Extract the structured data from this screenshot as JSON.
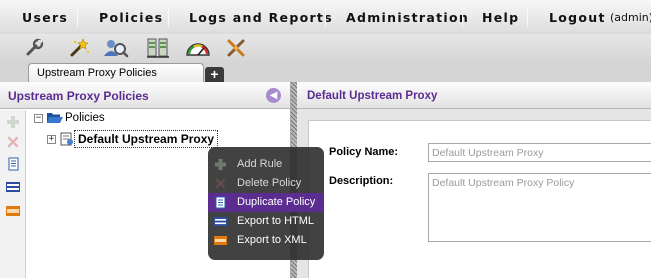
{
  "menu": {
    "items": [
      "Users",
      "Policies",
      "Logs and Reports",
      "Administration",
      "Help",
      "Logout"
    ],
    "user_badge": "(admin)"
  },
  "toolbar": {
    "icons": [
      "wrench-icon",
      "wand-icon",
      "user-search-icon",
      "server-icon",
      "gauge-icon",
      "crossed-tools-icon"
    ]
  },
  "tabs": {
    "active_tab_label": "Upstream Proxy Policies",
    "new_tab_label": "+"
  },
  "left_panel": {
    "title": "Upstream Proxy Policies",
    "tree": {
      "root_label": "Policies",
      "child_label": "Default Upstream Proxy"
    },
    "side_icons": [
      "add-icon",
      "delete-icon",
      "duplicate-icon",
      "html-export-icon",
      "xml-export-icon"
    ]
  },
  "context_menu": {
    "items": [
      {
        "label": "Add Rule",
        "icon": "add-icon",
        "state": "disabled"
      },
      {
        "label": "Delete Policy",
        "icon": "delete-icon",
        "state": "disabled"
      },
      {
        "label": "Duplicate Policy",
        "icon": "duplicate-icon",
        "state": "active"
      },
      {
        "label": "Export to HTML",
        "icon": "html-export-icon",
        "state": "enabled"
      },
      {
        "label": "Export to XML",
        "icon": "xml-export-icon",
        "state": "enabled"
      }
    ]
  },
  "right_panel": {
    "title": "Default Upstream Proxy",
    "policy_name_label": "Policy Name:",
    "policy_name_value": "Default Upstream Proxy",
    "description_label": "Description:",
    "description_value": "Default Upstream Proxy Policy"
  },
  "colors": {
    "accent_purple": "#5c2d91",
    "title_purple": "#5b2c91",
    "context_menu_bg": "#282828"
  }
}
